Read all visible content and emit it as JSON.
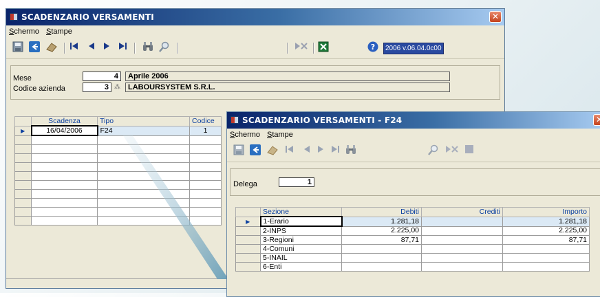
{
  "win1": {
    "title": "SCADENZARIO VERSAMENTI",
    "close": "✕",
    "menu": [
      "Schermo",
      "Stampe"
    ],
    "toolbar_version": "2006 v.06.04.0c00",
    "mese_label": "Mese",
    "mese_num": "4",
    "mese_text": "Aprile   2006",
    "azienda_label": "Codice azienda",
    "azienda_num": "3",
    "azienda_text": "LABOURSYSTEM S.R.L.",
    "columns": [
      "Scadenza",
      "Tipo",
      "Codice"
    ],
    "rows": [
      {
        "scadenza": "16/04/2006",
        "tipo": "F24",
        "codice": "1"
      }
    ]
  },
  "win2": {
    "title": "SCADENZARIO VERSAMENTI - F24",
    "menu": [
      "Schermo",
      "Stampe"
    ],
    "delega_label": "Delega",
    "delega_value": "1",
    "columns": [
      "Sezione",
      "Debiti",
      "Crediti",
      "Importo"
    ],
    "rows": [
      {
        "sezione": "1-Erario",
        "debiti": "1.281,18",
        "crediti": "",
        "importo": "1.281,18"
      },
      {
        "sezione": "2-INPS",
        "debiti": "2.225,00",
        "crediti": "",
        "importo": "2.225,00"
      },
      {
        "sezione": "3-Regioni",
        "debiti": "87,71",
        "crediti": "",
        "importo": "87,71"
      },
      {
        "sezione": "4-Comuni",
        "debiti": "",
        "crediti": "",
        "importo": ""
      },
      {
        "sezione": "5-INAIL",
        "debiti": "",
        "crediti": "",
        "importo": ""
      },
      {
        "sezione": "6-Enti",
        "debiti": "",
        "crediti": "",
        "importo": ""
      }
    ]
  },
  "icons": {
    "save": "floppy-icon",
    "back": "back-arrow-icon",
    "erase": "eraser-icon",
    "first": "first-record-icon",
    "prev": "prev-record-icon",
    "next": "next-record-icon",
    "last": "last-record-icon",
    "find": "binoculars-icon",
    "zoom": "magnifier-icon",
    "export": "export-icon",
    "excel": "excel-icon",
    "help": "help-icon"
  },
  "colors": {
    "title_dark": "#0a246a",
    "title_light": "#a6caf0",
    "grid_header": "#0b40a0",
    "close_red": "#c4431d"
  }
}
